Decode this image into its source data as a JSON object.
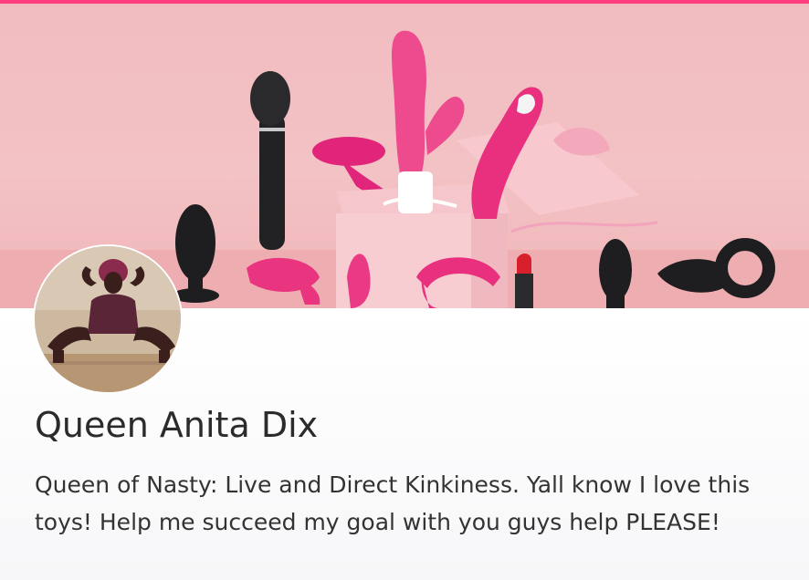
{
  "profile": {
    "name": "Queen Anita Dix",
    "bio": "Queen of Nasty: Live and Direct Kinkiness. Yall know I love this toys! Help me succeed my goal with you guys help PLEASE!"
  },
  "theme": {
    "accent": "#ff3d7f",
    "cover_background": "#f3c2c4",
    "text": "#2b2b2b"
  }
}
